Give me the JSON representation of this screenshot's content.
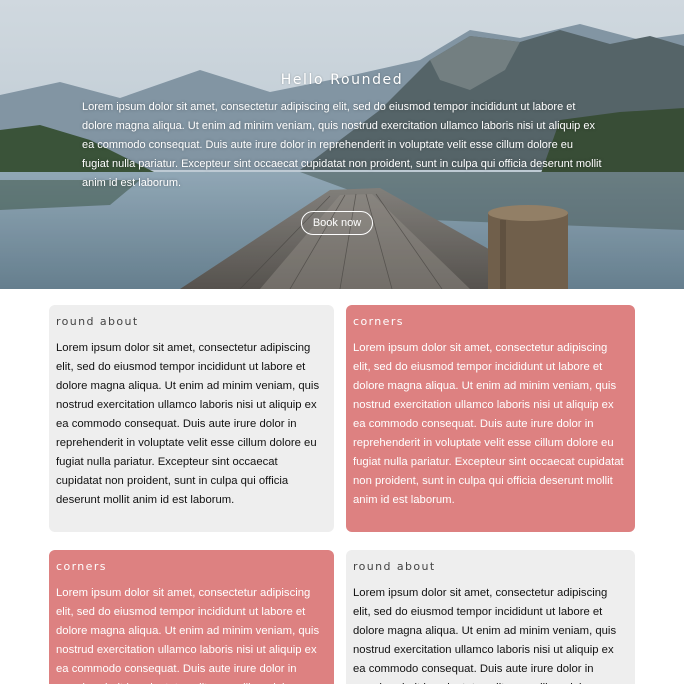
{
  "hero": {
    "title": "Hello Rounded",
    "text": "Lorem ipsum dolor sit amet, consectetur adipiscing elit, sed do eiusmod tempor incididunt ut labore et dolore magna aliqua. Ut enim ad minim veniam, quis nostrud exercitation ullamco laboris nisi ut aliquip ex ea commodo consequat. Duis aute irure dolor in reprehenderit in voluptate velit esse cillum dolore eu fugiat nulla pariatur. Excepteur sint occaecat cupidatat non proident, sunt in culpa qui officia deserunt mollit anim id est laborum.",
    "button_label": "Book now"
  },
  "cards": [
    {
      "title": "round about",
      "style": "gray",
      "body": "Lorem ipsum dolor sit amet, consectetur adipiscing elit, sed do eiusmod tempor incididunt ut labore et dolore magna aliqua. Ut enim ad minim veniam, quis nostrud exercitation ullamco laboris nisi ut aliquip ex ea commodo consequat. Duis aute irure dolor in reprehenderit in voluptate velit esse cillum dolore eu fugiat nulla pariatur. Excepteur sint occaecat cupidatat non proident, sunt in culpa qui officia deserunt mollit anim id est laborum."
    },
    {
      "title": "corners",
      "style": "red",
      "body": "Lorem ipsum dolor sit amet, consectetur adipiscing elit, sed do eiusmod tempor incididunt ut labore et dolore magna aliqua. Ut enim ad minim veniam, quis nostrud exercitation ullamco laboris nisi ut aliquip ex ea commodo consequat. Duis aute irure dolor in reprehenderit in voluptate velit esse cillum dolore eu fugiat nulla pariatur. Excepteur sint occaecat cupidatat non proident, sunt in culpa qui officia deserunt mollit anim id est laborum."
    },
    {
      "title": "corners",
      "style": "red",
      "body": "Lorem ipsum dolor sit amet, consectetur adipiscing elit, sed do eiusmod tempor incididunt ut labore et dolore magna aliqua. Ut enim ad minim veniam, quis nostrud exercitation ullamco laboris nisi ut aliquip ex ea commodo consequat. Duis aute irure dolor in reprehenderit in voluptate velit esse cillum dolore eu fugiat nulla pariatur."
    },
    {
      "title": "round about",
      "style": "gray",
      "body": "Lorem ipsum dolor sit amet, consectetur adipiscing elit, sed do eiusmod tempor incididunt ut labore et dolore magna aliqua. Ut enim ad minim veniam, quis nostrud exercitation ullamco laboris nisi ut aliquip ex ea commodo consequat. Duis aute irure dolor in reprehenderit in voluptate velit esse cillum dolore eu fugiat nulla pariatur."
    }
  ],
  "colors": {
    "card_gray": "#eeeeee",
    "card_red": "#dd8181",
    "text_dark": "#111111",
    "text_light": "#ffffff"
  }
}
